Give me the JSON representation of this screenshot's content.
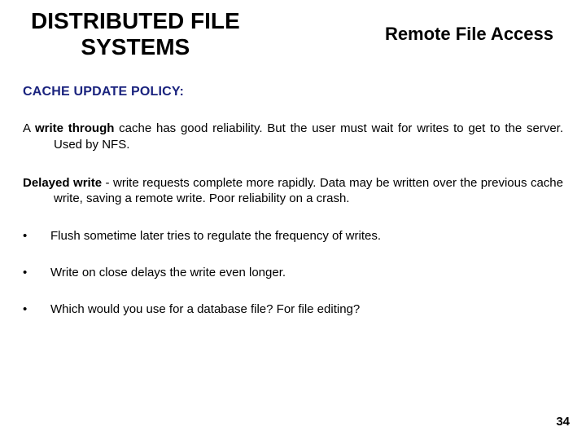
{
  "header": {
    "title_line1": "DISTRIBUTED FILE",
    "title_line2": "SYSTEMS",
    "subtitle": "Remote File Access"
  },
  "section_heading": "CACHE UPDATE POLICY:",
  "para1": {
    "lead_bold": "write through",
    "prefix": "A ",
    "rest": " cache has good reliability. But the user must wait for writes to get to the server. Used by NFS."
  },
  "para2": {
    "lead_bold": "Delayed write",
    "rest": " - write requests complete more rapidly. Data may be written over the previous cache write, saving a remote write. Poor reliability on a crash."
  },
  "bullets": [
    "Flush sometime later tries to regulate the frequency of writes.",
    "Write on close delays the write even longer.",
    "Which would you use for a database file? For file editing?"
  ],
  "page_number": "34"
}
